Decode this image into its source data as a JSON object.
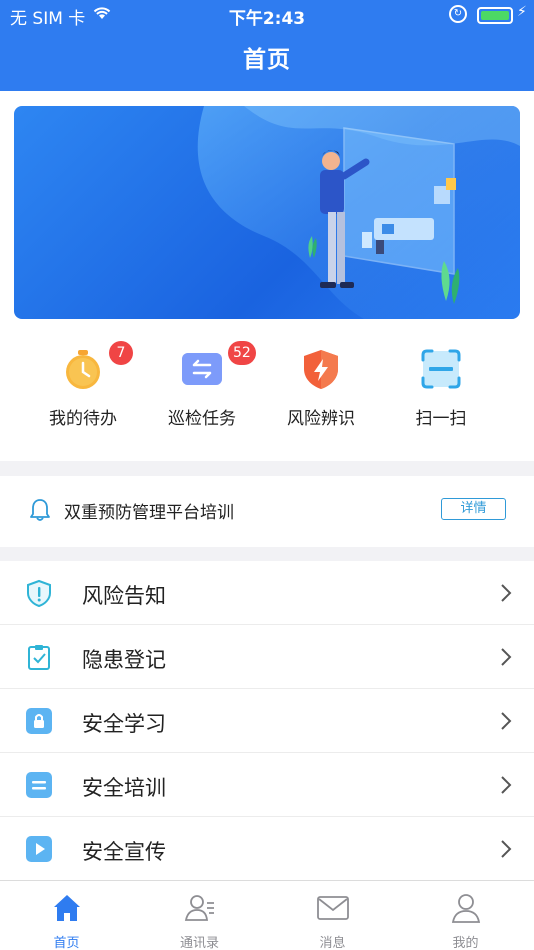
{
  "status_bar": {
    "carrier": "无 SIM 卡",
    "time": "下午2:43",
    "battery_level": 1.0
  },
  "header": {
    "title": "首页"
  },
  "shortcuts": [
    {
      "label": "我的待办",
      "badge": "7",
      "icon": "clock-icon"
    },
    {
      "label": "巡检任务",
      "badge": "52",
      "icon": "swap-arrows-icon"
    },
    {
      "label": "风险辨识",
      "badge": "",
      "icon": "lightning-shield-icon"
    },
    {
      "label": "扫一扫",
      "badge": "",
      "icon": "scan-icon"
    }
  ],
  "notice": {
    "text": "双重预防管理平台培训",
    "detail_label": "详情"
  },
  "menu": [
    {
      "label": "风险告知",
      "icon": "shield-alert-icon"
    },
    {
      "label": "隐患登记",
      "icon": "clipboard-check-icon"
    },
    {
      "label": "安全学习",
      "icon": "lock-icon"
    },
    {
      "label": "安全培训",
      "icon": "list-icon"
    },
    {
      "label": "安全宣传",
      "icon": "play-icon"
    }
  ],
  "tabbar": [
    {
      "label": "首页",
      "icon": "home-icon",
      "active": true
    },
    {
      "label": "通讯录",
      "icon": "contacts-icon",
      "active": false
    },
    {
      "label": "消息",
      "icon": "mail-icon",
      "active": false
    },
    {
      "label": "我的",
      "icon": "person-icon",
      "active": false
    }
  ],
  "colors": {
    "primary": "#2f7cf0",
    "badge": "#f04545",
    "accent_cyan": "#2f9ad8",
    "background": "#f2f2f5"
  }
}
